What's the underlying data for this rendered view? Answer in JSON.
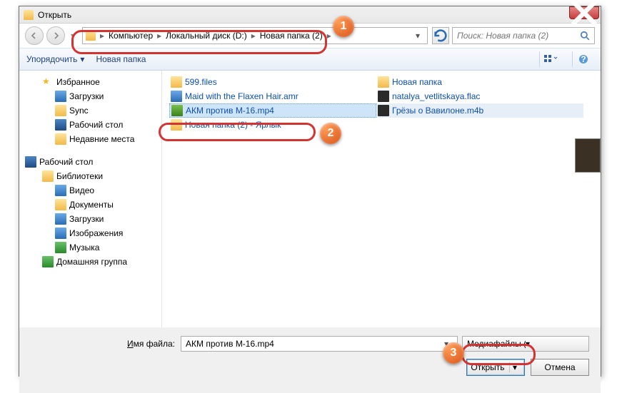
{
  "titlebar": {
    "title": "Открыть"
  },
  "breadcrumbs": {
    "seg1": "Компьютер",
    "seg2": "Локальный диск (D:)",
    "seg3": "Новая папка (2)"
  },
  "search": {
    "placeholder": "Поиск: Новая папка (2)"
  },
  "toolbar": {
    "organize": "Упорядочить",
    "newfolder": "Новая папка"
  },
  "sidebar": {
    "favorites": "Избранное",
    "downloads": "Загрузки",
    "sync": "Sync",
    "desktop": "Рабочий стол",
    "recent": "Недавние места",
    "desktop2": "Рабочий стол",
    "libraries": "Библиотеки",
    "videos": "Видео",
    "documents": "Документы",
    "downloads2": "Загрузки",
    "pictures": "Изображения",
    "music": "Музыка",
    "homegroup": "Домашняя группа"
  },
  "files": {
    "c1": [
      {
        "name": "599.files",
        "icon": "folder"
      },
      {
        "name": "Maid with the Flaxen Hair.amr",
        "icon": "amr"
      },
      {
        "name": "АКМ против М-16.mp4",
        "icon": "mp4",
        "selected": true
      },
      {
        "name": "Новая папка (2) - Ярлык",
        "icon": "folder"
      }
    ],
    "c2": [
      {
        "name": "Новая папка",
        "icon": "folder"
      },
      {
        "name": "natalya_vetlitskaya.flac",
        "icon": "flac"
      },
      {
        "name": "Грёзы о Вавилоне.m4b",
        "icon": "m4b",
        "hl": true
      }
    ]
  },
  "bottom": {
    "filename_label": "Имя файла:",
    "filename_value": "АКМ против М-16.mp4",
    "filetype": "Медиафайлы (все типы) (*.wn",
    "open": "Открыть",
    "cancel": "Отмена"
  }
}
